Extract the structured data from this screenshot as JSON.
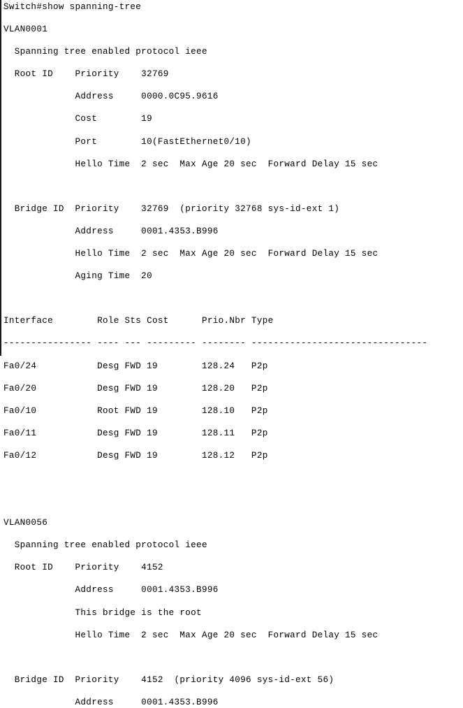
{
  "terminal": {
    "device_name": "Switch",
    "prompt_symbol": "#",
    "command": "show spanning-tree",
    "prompt_line": "Switch#show spanning-tree",
    "colors": {
      "background": "#ffffff",
      "foreground": "#000000",
      "border": "#1a1a1a"
    }
  },
  "vlans": [
    {
      "name": "VLAN0001",
      "protocol_line": "  Spanning tree enabled protocol ieee",
      "root_id": {
        "label": "Root ID",
        "priority": "32769",
        "address": "0000.0C95.9616",
        "cost": "19",
        "port": "10(FastEthernet0/10)",
        "hello_time": "2 sec",
        "max_age": "20 sec",
        "forward_delay": "15 sec"
      },
      "bridge_id": {
        "label": "Bridge ID",
        "priority": "32769",
        "priority_detail": "(priority 32768 sys-id-ext 1)",
        "address": "0001.4353.B996",
        "hello_time": "2 sec",
        "max_age": "20 sec",
        "forward_delay": "15 sec",
        "aging_time": "20"
      },
      "table": {
        "headers": [
          "Interface",
          "Role",
          "Sts",
          "Cost",
          "Prio.Nbr",
          "Type"
        ],
        "separator": [
          "----------------",
          "----",
          "---",
          "---------",
          "--------",
          "--------------------------------"
        ],
        "rows": [
          {
            "interface": "Fa0/24",
            "role": "Desg",
            "sts": "FWD",
            "cost": "19",
            "prio_nbr": "128.24",
            "type": "P2p"
          },
          {
            "interface": "Fa0/20",
            "role": "Desg",
            "sts": "FWD",
            "cost": "19",
            "prio_nbr": "128.20",
            "type": "P2p"
          },
          {
            "interface": "Fa0/10",
            "role": "Root",
            "sts": "FWD",
            "cost": "19",
            "prio_nbr": "128.10",
            "type": "P2p"
          },
          {
            "interface": "Fa0/11",
            "role": "Desg",
            "sts": "FWD",
            "cost": "19",
            "prio_nbr": "128.11",
            "type": "P2p"
          },
          {
            "interface": "Fa0/12",
            "role": "Desg",
            "sts": "FWD",
            "cost": "19",
            "prio_nbr": "128.12",
            "type": "P2p"
          }
        ]
      }
    },
    {
      "name": "VLAN0056",
      "protocol_line": "  Spanning tree enabled protocol ieee",
      "root_id": {
        "label": "Root ID",
        "priority": "4152",
        "address": "0001.4353.B996",
        "root_note": "This bridge is the root",
        "hello_time": "2 sec",
        "max_age": "20 sec",
        "forward_delay": "15 sec"
      },
      "bridge_id": {
        "label": "Bridge ID",
        "priority": "4152",
        "priority_detail": "(priority 4096 sys-id-ext 56)",
        "address": "0001.4353.B996"
      }
    }
  ],
  "lines": [
    "Switch#show spanning-tree",
    "VLAN0001",
    "  Spanning tree enabled protocol ieee",
    "  Root ID    Priority    32769",
    "             Address     0000.0C95.9616",
    "             Cost        19",
    "             Port        10(FastEthernet0/10)",
    "             Hello Time  2 sec  Max Age 20 sec  Forward Delay 15 sec",
    "",
    "  Bridge ID  Priority    32769  (priority 32768 sys-id-ext 1)",
    "             Address     0001.4353.B996",
    "             Hello Time  2 sec  Max Age 20 sec  Forward Delay 15 sec",
    "             Aging Time  20",
    "",
    "Interface        Role Sts Cost      Prio.Nbr Type",
    "---------------- ---- --- --------- -------- --------------------------------",
    "Fa0/24           Desg FWD 19        128.24   P2p",
    "Fa0/20           Desg FWD 19        128.20   P2p",
    "Fa0/10           Root FWD 19        128.10   P2p",
    "Fa0/11           Desg FWD 19        128.11   P2p",
    "Fa0/12           Desg FWD 19        128.12   P2p",
    "",
    "",
    "VLAN0056",
    "  Spanning tree enabled protocol ieee",
    "  Root ID    Priority    4152",
    "             Address     0001.4353.B996",
    "             This bridge is the root",
    "             Hello Time  2 sec  Max Age 20 sec  Forward Delay 15 sec",
    "",
    "  Bridge ID  Priority    4152  (priority 4096 sys-id-ext 56)",
    "             Address     0001.4353.B996"
  ]
}
